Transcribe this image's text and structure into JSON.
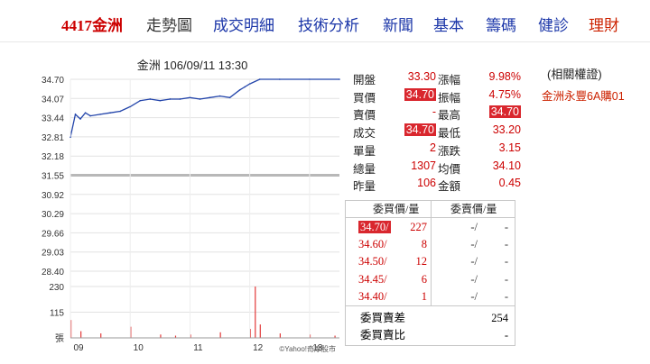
{
  "nav": {
    "stock": "4417金洲",
    "items": [
      "走勢圖",
      "成交明細",
      "技術分析",
      "新聞",
      "基本",
      "籌碼",
      "健診"
    ],
    "last": "理財"
  },
  "chart": {
    "title": "金洲 106/09/11 13:30",
    "price_ticks": [
      "34.70",
      "34.07",
      "33.44",
      "32.81",
      "32.18",
      "31.55",
      "30.92",
      "30.29",
      "29.66",
      "29.03",
      "28.40"
    ],
    "volume_ticks": [
      "230",
      "115",
      "張"
    ],
    "time_ticks": [
      "09",
      "10",
      "11",
      "12",
      "13"
    ],
    "reference_price": 31.55,
    "credit": "©Yahoo!奇摩股市",
    "line_color": "#2244aa",
    "volume_color": "#e23a3a"
  },
  "chart_data": {
    "type": "line",
    "title": "金洲 106/09/11 13:30",
    "ylim": [
      28.4,
      34.7
    ],
    "price_series": {
      "x": [
        "09:00",
        "09:05",
        "09:10",
        "09:15",
        "09:20",
        "09:30",
        "09:40",
        "09:50",
        "10:00",
        "10:10",
        "10:20",
        "10:30",
        "10:40",
        "10:50",
        "11:00",
        "11:10",
        "11:20",
        "11:30",
        "11:40",
        "11:50",
        "11:55",
        "12:00",
        "12:10",
        "12:30",
        "13:00",
        "13:30"
      ],
      "values": [
        32.8,
        33.55,
        33.4,
        33.6,
        33.5,
        33.55,
        33.6,
        33.65,
        33.8,
        34.0,
        34.05,
        34.0,
        34.05,
        34.05,
        34.1,
        34.05,
        34.1,
        34.15,
        34.1,
        34.35,
        34.45,
        34.55,
        34.7,
        34.7,
        34.7,
        34.7
      ]
    },
    "volume_series": {
      "ylim": [
        0,
        230
      ],
      "x": [
        "09:00",
        "09:10",
        "09:30",
        "10:00",
        "10:30",
        "10:45",
        "11:00",
        "11:30",
        "12:00",
        "12:05",
        "12:10",
        "12:30",
        "13:00",
        "13:25"
      ],
      "values": [
        80,
        30,
        20,
        50,
        15,
        10,
        15,
        25,
        40,
        230,
        60,
        20,
        15,
        10
      ]
    }
  },
  "quote": {
    "left": [
      {
        "label": "開盤",
        "value": "33.30",
        "hl": false
      },
      {
        "label": "買價",
        "value": "34.70",
        "hl": true
      },
      {
        "label": "賣價",
        "value": "-",
        "hl": false
      },
      {
        "label": "成交",
        "value": "34.70",
        "hl": true
      },
      {
        "label": "單量",
        "value": "2",
        "hl": false
      },
      {
        "label": "總量",
        "value": "1307",
        "hl": false
      },
      {
        "label": "昨量",
        "value": "106",
        "hl": false
      }
    ],
    "right": [
      {
        "label": "漲幅",
        "value": "9.98%",
        "hl": false
      },
      {
        "label": "振幅",
        "value": "4.75%",
        "hl": false
      },
      {
        "label": "最高",
        "value": "34.70",
        "hl": true
      },
      {
        "label": "最低",
        "value": "33.20",
        "hl": false
      },
      {
        "label": "漲跌",
        "value": "3.15",
        "hl": false
      },
      {
        "label": "均價",
        "value": "34.10",
        "hl": false
      },
      {
        "label": "金額",
        "value": "0.45",
        "hl": false
      }
    ]
  },
  "orderbook": {
    "bid_header": "委買價/量",
    "ask_header": "委賣價/量",
    "rows": [
      {
        "bid_price": "34.70",
        "bid_vol": "227",
        "hl": true,
        "ask_price": "-/",
        "ask_vol": "-"
      },
      {
        "bid_price": "34.60",
        "bid_vol": "8",
        "hl": false,
        "ask_price": "-/",
        "ask_vol": "-"
      },
      {
        "bid_price": "34.50",
        "bid_vol": "12",
        "hl": false,
        "ask_price": "-/",
        "ask_vol": "-"
      },
      {
        "bid_price": "34.45",
        "bid_vol": "6",
        "hl": false,
        "ask_price": "-/",
        "ask_vol": "-"
      },
      {
        "bid_price": "34.40",
        "bid_vol": "1",
        "hl": false,
        "ask_price": "-/",
        "ask_vol": "-"
      }
    ],
    "diff_label": "委買賣差",
    "diff_value": "254",
    "ratio_label": "委買賣比",
    "ratio_value": "-"
  },
  "warrants": {
    "title": "(相關權證)",
    "item": "金洲永豐6A購01"
  },
  "colors": {
    "nav_link": "#1a35a8",
    "up_red": "#d9272e",
    "quote_value": "#cc0000"
  }
}
